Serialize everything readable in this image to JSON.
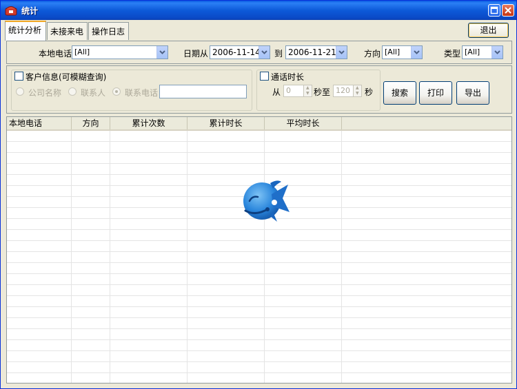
{
  "window": {
    "title": "统计"
  },
  "tabs": [
    {
      "label": "统计分析",
      "active": true
    },
    {
      "label": "未接来电",
      "active": false
    },
    {
      "label": "操作日志",
      "active": false
    }
  ],
  "exit_label": "退出",
  "filters": {
    "local_phone_label": "本地电话",
    "local_phone_value": "[All]",
    "date_from_label": "日期从",
    "date_from_value": "2006-11-14",
    "date_to_label": "到",
    "date_to_value": "2006-11-21",
    "direction_label": "方向",
    "direction_value": "[All]",
    "type_label": "类型",
    "type_value": "[All]"
  },
  "customer_group": {
    "label": "客户信息(可模糊查询)",
    "options": [
      "公司名称",
      "联系人",
      "联系电话"
    ],
    "selected": "联系电话",
    "input_value": ""
  },
  "duration_group": {
    "label": "通话时长",
    "from_label": "从",
    "from_value": "0",
    "to_label": "秒至",
    "to_value": "120",
    "unit_label": "秒"
  },
  "actions": {
    "search": "搜索",
    "print": "打印",
    "export": "导出"
  },
  "table": {
    "columns": [
      "本地电话",
      "方向",
      "累计次数",
      "累计时长",
      "平均时长"
    ],
    "rows": []
  },
  "colors": {
    "title_bar": "#0a5be2",
    "tab_highlight": "#f1a826",
    "window_bg": "#ece9d8"
  },
  "icons": {
    "app": "phone-icon",
    "watermark": "fish-logo-icon"
  }
}
